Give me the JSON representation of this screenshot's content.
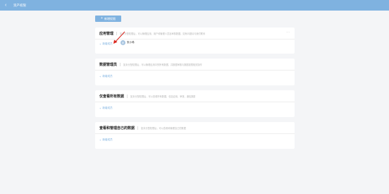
{
  "topbar": {
    "back_icon": "‹",
    "title": "资产权限"
  },
  "toolbar": {
    "add_label": "新增权限"
  },
  "cards": [
    {
      "title": "应用管理",
      "desc": "如未分配权限后，可以管理应用、用户和管理人员及审核数据，如有问题请与我们联系",
      "add_label": "新增成员",
      "member": {
        "avatar": "张",
        "name": "张小希"
      },
      "has_more": true
    },
    {
      "title": "数据管理员",
      "desc": "如未分配权限后，可以管理应用中的所有数据，并数据审核与数据权限相关操作",
      "add_label": "新增成员"
    },
    {
      "title": "仅查看所有数据",
      "desc": "如未分配权限后，可以查看所有数据，包括应用，审核，通信数据",
      "add_label": "新增成员"
    },
    {
      "title": "查看和管理自己的数据",
      "desc": "如未分配权限后，可以查看和管理自己的数据",
      "add_label": "新增成员"
    }
  ],
  "colors": {
    "accent": "#7fb2e0",
    "annotation": "#d9251d"
  }
}
